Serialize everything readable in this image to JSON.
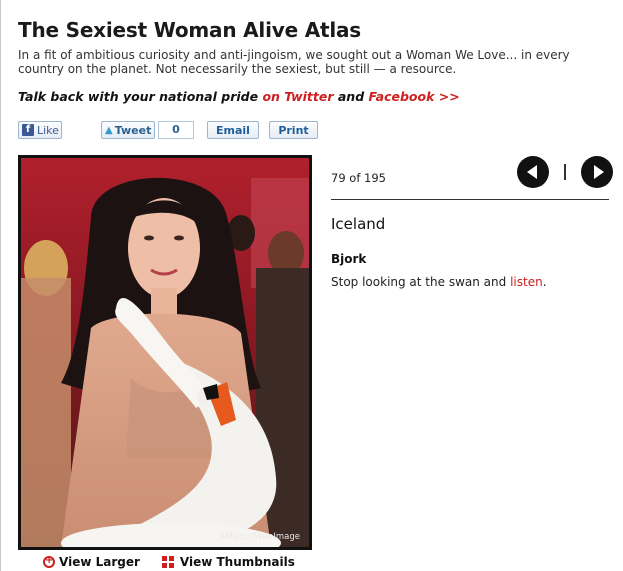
{
  "header": {
    "title": "The Sexiest Woman Alive Atlas",
    "intro": "In a fit of ambitious curiosity and anti-jingoism, we sought out a Woman We Love... in every country on the planet. Not necessarily the sexiest, but still — a resource.",
    "talkback_prefix": "Talk back with your national pride",
    "talkback_twitter": "on Twitter",
    "talkback_and": "and",
    "talkback_facebook": "Facebook >>"
  },
  "share": {
    "like_label": "Like",
    "tweet_label": "Tweet",
    "tweet_count": "0",
    "email_label": "Email",
    "print_label": "Print"
  },
  "photo": {
    "credit": "KMazur/WireImage",
    "view_larger": "View Larger",
    "view_thumbnails": "View Thumbnails"
  },
  "entry": {
    "counter": "79 of 195",
    "country": "Iceland",
    "name": "Bjork",
    "desc_text": "Stop looking at the swan and",
    "desc_link": "listen",
    "desc_end": "."
  },
  "colors": {
    "link_red": "#cc1f1f",
    "facebook_blue": "#3b5998"
  },
  "icons": {
    "prev": "arrow-left-icon",
    "next": "arrow-right-icon",
    "zoom": "zoom-plus-icon",
    "thumbnails": "grid-icon"
  }
}
